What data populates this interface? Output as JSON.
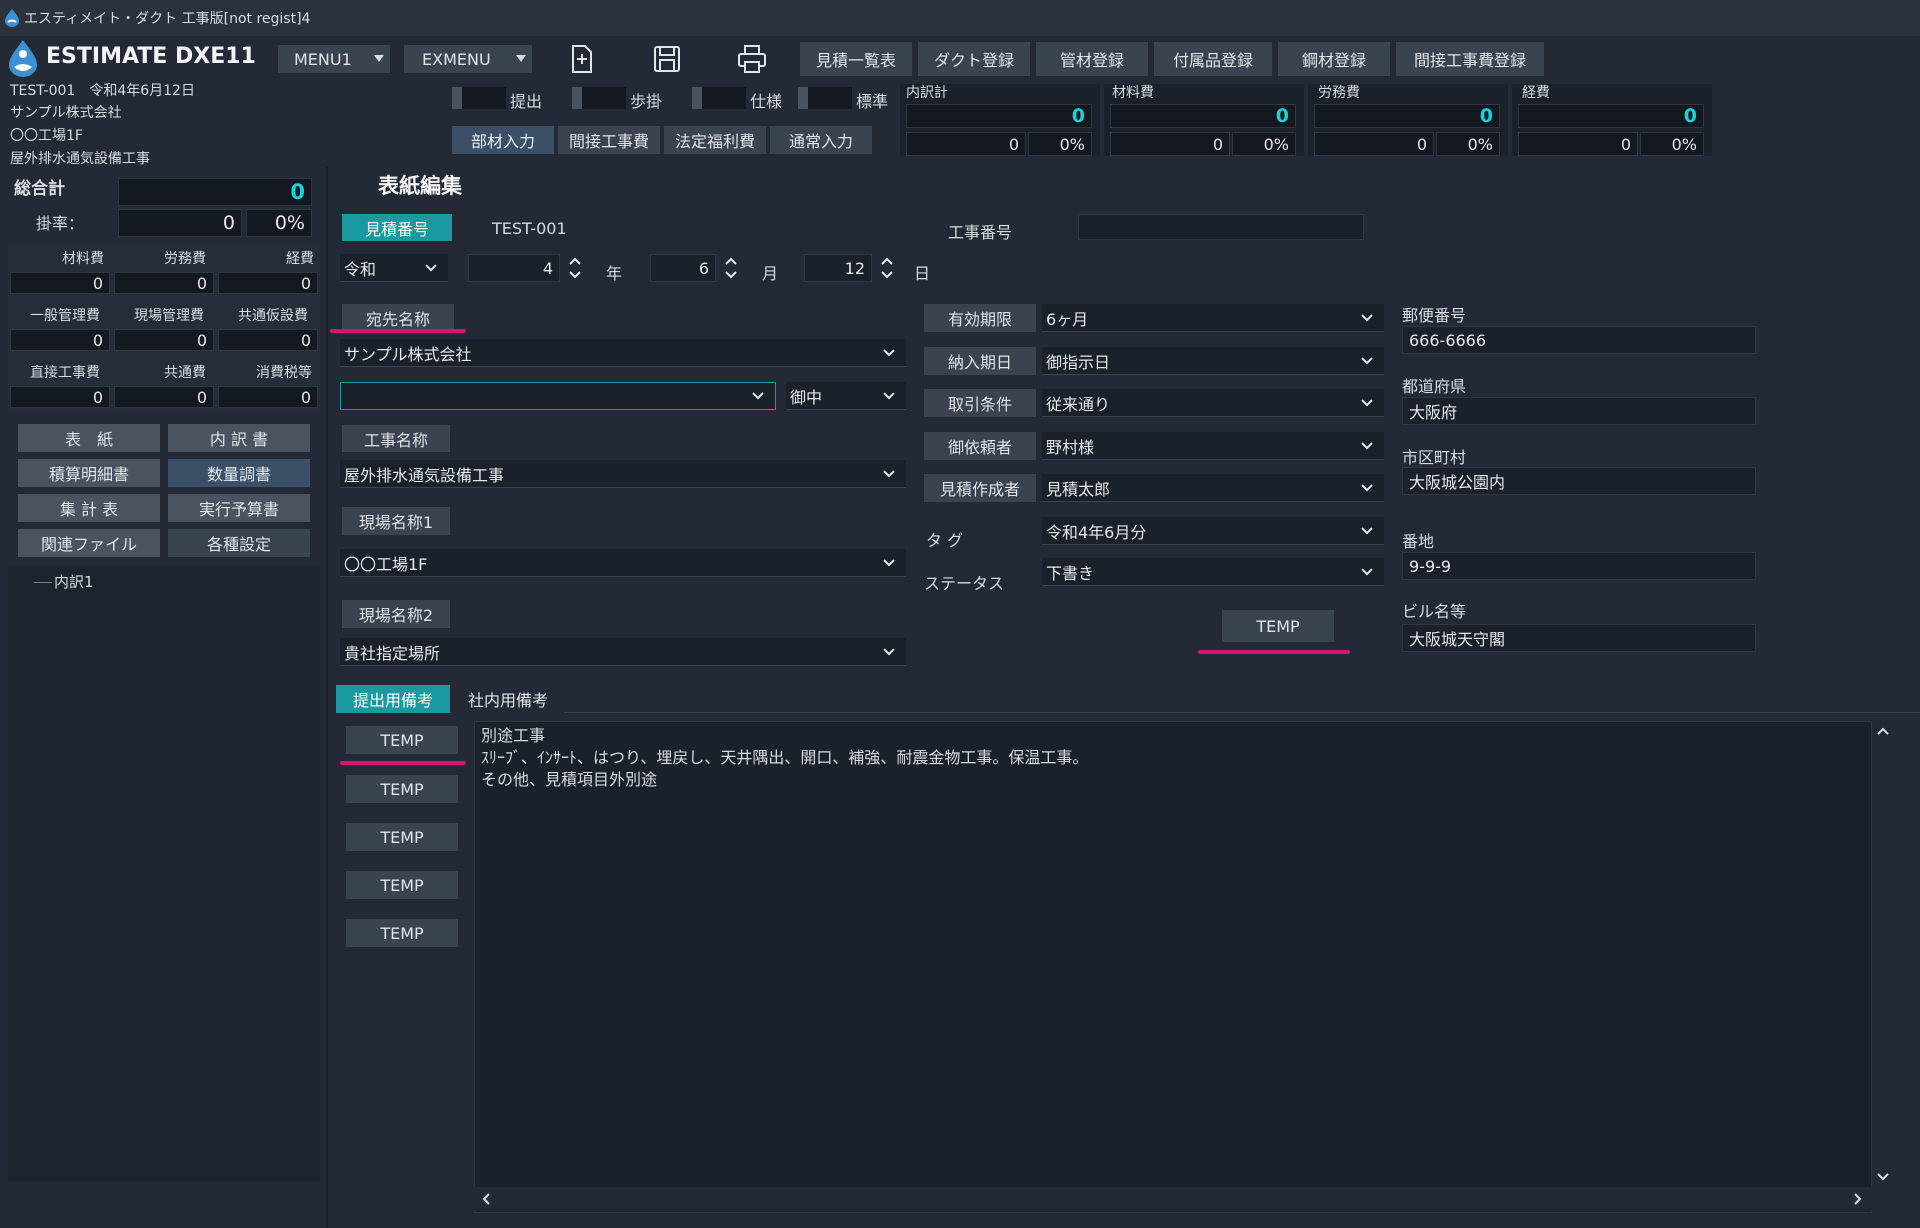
{
  "window": {
    "title": "エスティメイト・ダクト 工事版[not regist]4"
  },
  "app": {
    "logo_text": "ESTIMATE DXE11",
    "menu1": "MENU1",
    "exmenu": "EXMENU"
  },
  "toolbar": {
    "new_icon": "new-document-icon",
    "save_icon": "save-icon",
    "print_icon": "print-icon",
    "buttons": [
      "見積一覧表",
      "ダクト登録",
      "管材登録",
      "付属品登録",
      "鋼材登録",
      "間接工事費登録"
    ]
  },
  "header_info": {
    "line1": "TEST-001　令和4年6月12日",
    "line2": "サンプル株式会社",
    "line3": "〇〇工場1F",
    "line4": "屋外排水通気設備工事"
  },
  "toggles": [
    "提出",
    "歩掛",
    "仕様",
    "標準"
  ],
  "input_modes": [
    "部材入力",
    "間接工事費",
    "法定福利費",
    "通常入力"
  ],
  "summaries": [
    {
      "label": "内訳計",
      "total": "0",
      "sub": "0",
      "pct": "0%"
    },
    {
      "label": "材料費",
      "total": "0",
      "sub": "0",
      "pct": "0%"
    },
    {
      "label": "労務費",
      "total": "0",
      "sub": "0",
      "pct": "0%"
    },
    {
      "label": "経費",
      "total": "0",
      "sub": "0",
      "pct": "0%"
    }
  ],
  "left": {
    "grand_total_label": "総合計",
    "grand_total": "0",
    "rate_label": "掛率：",
    "rate_value": "0",
    "rate_pct": "0%",
    "grid": [
      {
        "l": "材料費",
        "v": "0"
      },
      {
        "l": "労務費",
        "v": "0"
      },
      {
        "l": "経費",
        "v": "0"
      },
      {
        "l": "一般管理費",
        "v": "0"
      },
      {
        "l": "現場管理費",
        "v": "0"
      },
      {
        "l": "共通仮設費",
        "v": "0"
      },
      {
        "l": "直接工事費",
        "v": "0"
      },
      {
        "l": "共通費",
        "v": "0"
      },
      {
        "l": "消費税等",
        "v": "0"
      }
    ],
    "nav": [
      "表　紙",
      "内 訳 書",
      "積算明細書",
      "数量調書",
      "集 計 表",
      "実行予算書",
      "関連ファイル",
      "各種設定"
    ],
    "tree_item": "内訳1"
  },
  "form": {
    "section_title": "表紙編集",
    "estimate_no_label": "見積番号",
    "estimate_no": "TEST-001",
    "project_no_label": "工事番号",
    "project_no": "",
    "era": "令和",
    "year": "4",
    "year_unit": "年",
    "month": "6",
    "month_unit": "月",
    "day": "12",
    "day_unit": "日",
    "addressee_label": "宛先名称",
    "addressee": "サンプル株式会社",
    "addressee2": "",
    "honorific": "御中",
    "project_name_label": "工事名称",
    "project_name": "屋外排水通気設備工事",
    "site1_label": "現場名称1",
    "site1": "〇〇工場1F",
    "site2_label": "現場名称2",
    "site2": "貴社指定場所",
    "validity_label": "有効期限",
    "validity": "6ヶ月",
    "delivery_label": "納入期日",
    "delivery": "御指示日",
    "terms_label": "取引条件",
    "terms": "従来通り",
    "requester_label": "御依頼者",
    "requester": "野村様",
    "author_label": "見積作成者",
    "author": "見積太郎",
    "tag_label": "タ グ",
    "tag": "令和4年6月分",
    "status_label": "ステータス",
    "status": "下書き",
    "temp_button": "TEMP",
    "postal_label": "郵便番号",
    "postal": "666-6666",
    "pref_label": "都道府県",
    "pref": "大阪府",
    "city_label": "市区町村",
    "city": "大阪城公園内",
    "address_label": "番地",
    "address": "9-9-9",
    "building_label": "ビル名等",
    "building": "大阪城天守閣"
  },
  "notes": {
    "tab_submit": "提出用備考",
    "tab_internal": "社内用備考",
    "temp_buttons": [
      "TEMP",
      "TEMP",
      "TEMP",
      "TEMP",
      "TEMP"
    ],
    "line1": "別途工事",
    "line2": "ｽﾘｰﾌﾞ、ｲﾝｻｰﾄ、はつり、埋戻し、天井隅出、開口、補強、耐震金物工事。保温工事。",
    "line3": "その他、見積項目外別途"
  },
  "colors": {
    "accent": "#1a9aa0",
    "highlight": "#d1186f",
    "teal_text": "#19d3d8"
  }
}
